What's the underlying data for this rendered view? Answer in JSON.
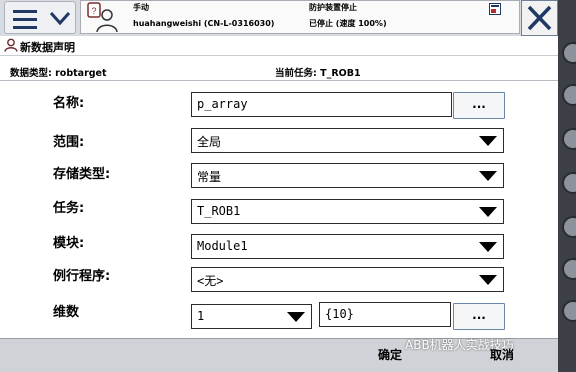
{
  "status": {
    "mode": "手动",
    "controller": "huahangweishi (CN-L-0316030)",
    "safety_state": "防护装置停止",
    "run_state": "已停止 (速度 100%)"
  },
  "title": "新数据声明",
  "info": {
    "data_type_label": "数据类型: robtarget",
    "current_task_label": "当前任务:  T_ROB1"
  },
  "form": {
    "name_label": "名称:",
    "name_value": "p_array",
    "scope_label": "范围:",
    "scope_value": "全局",
    "storage_label": "存储类型:",
    "storage_value": "常量",
    "task_label": "任务:",
    "task_value": "T_ROB1",
    "module_label": "模块:",
    "module_value": "Module1",
    "routine_label": "例行程序:",
    "routine_value": "<无>",
    "dimension_label": "维数",
    "dimension_value": "1",
    "dimension_size": "{10}",
    "dots_label": "..."
  },
  "footer": {
    "ok_label": "确定",
    "cancel_label": "取消",
    "watermark": "ABB机器人实战技巧"
  },
  "colors": {
    "topbar": "#d7dae0",
    "bottombar": "#cfd2d7",
    "accent": "#1f3864",
    "button_border": "#6a86a8"
  }
}
